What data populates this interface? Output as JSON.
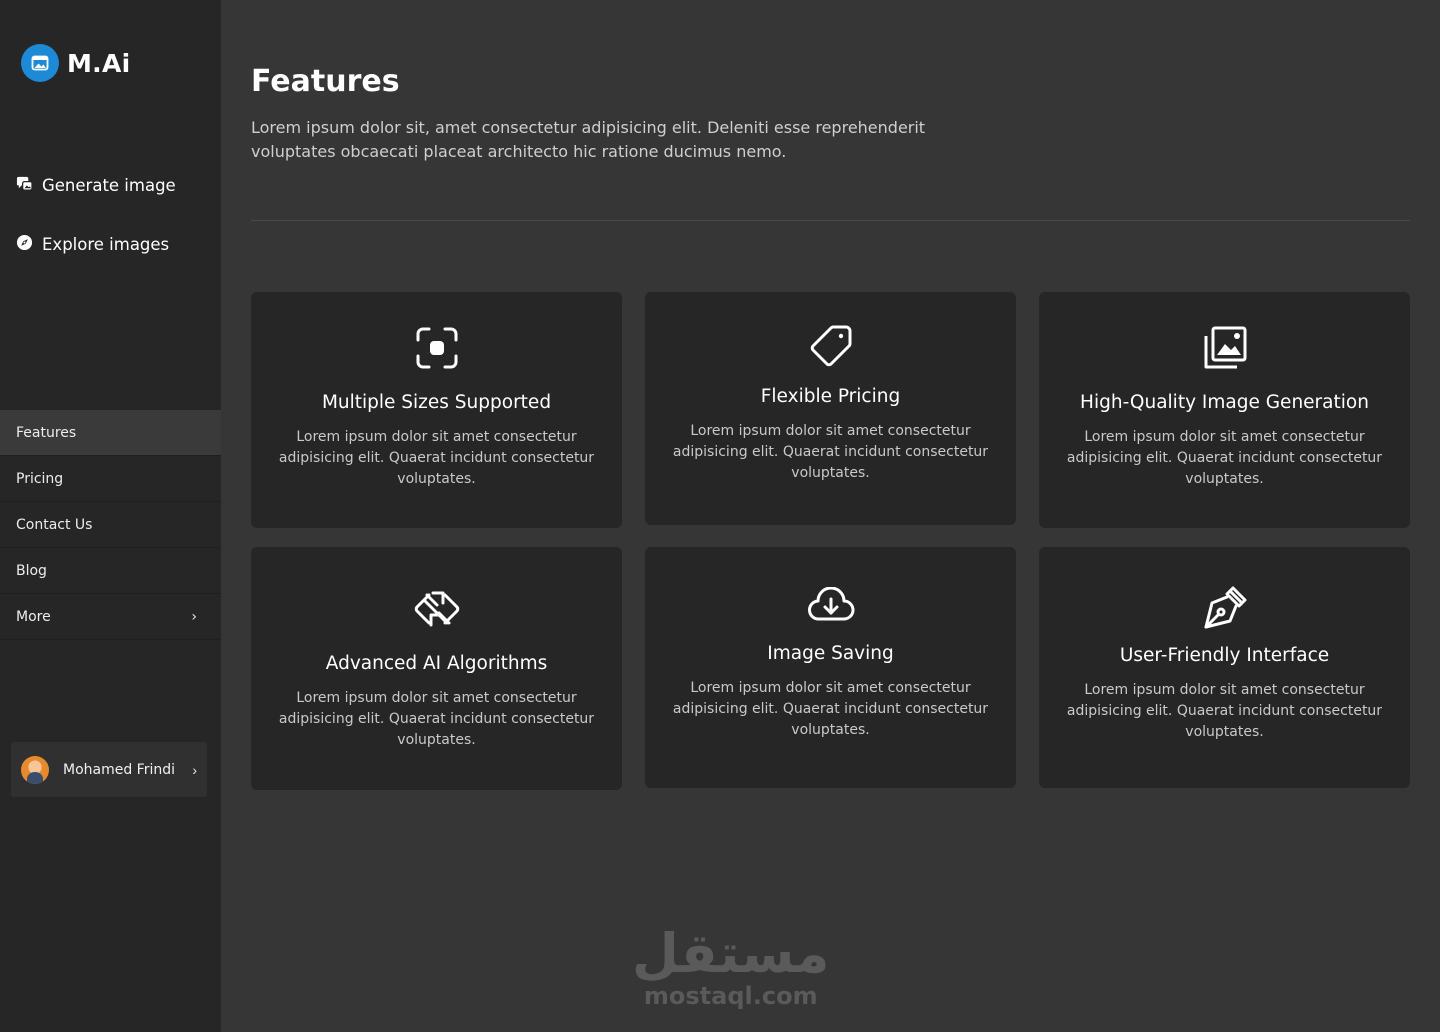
{
  "brand": {
    "name": "M.Ai",
    "logo_icon": "image-icon",
    "logo_color": "#1d8ad6"
  },
  "primary_nav": [
    {
      "label": "Generate image",
      "icon": "chat-image-icon"
    },
    {
      "label": "Explore images",
      "icon": "compass-icon"
    }
  ],
  "secondary_nav": [
    {
      "label": "Features",
      "active": true
    },
    {
      "label": "Pricing"
    },
    {
      "label": "Contact Us"
    },
    {
      "label": "Blog"
    },
    {
      "label": "More",
      "chevron": "›"
    }
  ],
  "user": {
    "name": "Mohamed Frindi",
    "chevron": "›"
  },
  "page": {
    "title": "Features",
    "description": "Lorem ipsum dolor sit, amet consectetur adipisicing elit. Deleniti esse reprehenderit voluptates obcaecati placeat architecto hic ratione ducimus nemo."
  },
  "features": [
    {
      "title": "Multiple Sizes Supported",
      "icon": "focus-frame-icon",
      "text": "Lorem ipsum dolor sit amet consectetur adipisicing elit. Quaerat incidunt consectetur voluptates."
    },
    {
      "title": "Flexible Pricing",
      "icon": "price-tag-icon",
      "text": "Lorem ipsum dolor sit amet consectetur adipisicing elit. Quaerat incidunt consectetur voluptates."
    },
    {
      "title": "High-Quality Image Generation",
      "icon": "image-gallery-icon",
      "text": "Lorem ipsum dolor sit amet consectetur adipisicing elit. Quaerat incidunt consectetur voluptates."
    },
    {
      "title": "Advanced AI Algorithms",
      "icon": "diamond-arrows-icon",
      "text": "Lorem ipsum dolor sit amet consectetur adipisicing elit. Quaerat incidunt consectetur voluptates."
    },
    {
      "title": "Image Saving",
      "icon": "cloud-download-icon",
      "text": "Lorem ipsum dolor sit amet consectetur adipisicing elit. Quaerat incidunt consectetur voluptates."
    },
    {
      "title": "User-Friendly Interface",
      "icon": "pen-nib-icon",
      "text": "Lorem ipsum dolor sit amet consectetur adipisicing elit. Quaerat incidunt consectetur voluptates."
    }
  ],
  "watermark": {
    "arabic": "مستقل",
    "latin": "mostaql.com"
  }
}
